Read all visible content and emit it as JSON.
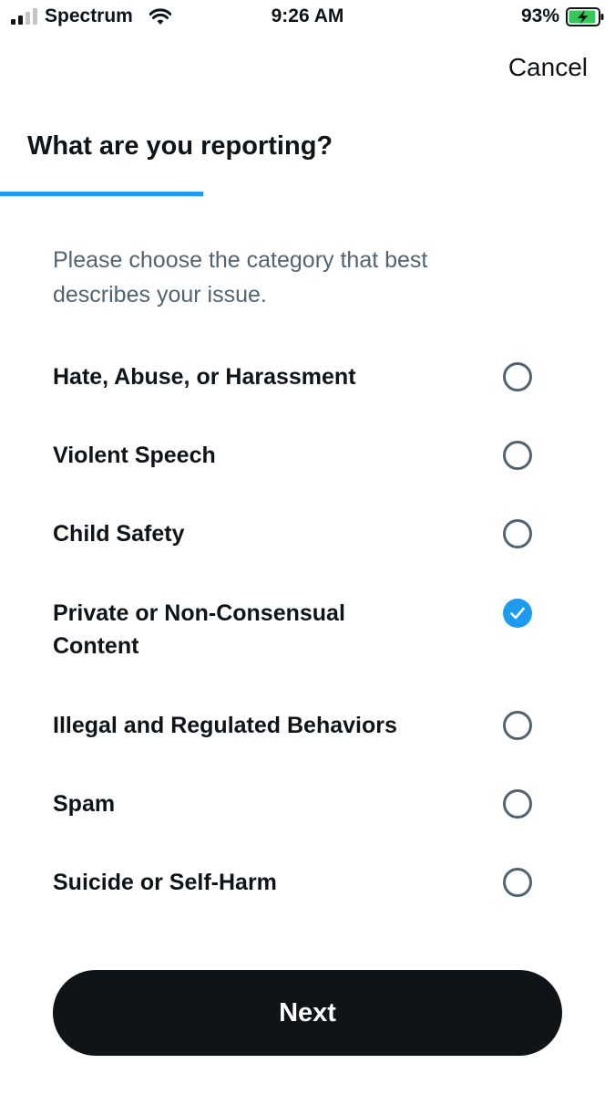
{
  "status_bar": {
    "carrier": "Spectrum",
    "time": "9:26 AM",
    "battery_percent": "93%",
    "battery_level": 0.93,
    "battery_charging": true,
    "signal_bars": 2,
    "battery_color": "#34c759"
  },
  "header": {
    "cancel_label": "Cancel",
    "title": "What are you reporting?",
    "progress": 0.33
  },
  "main": {
    "subtitle": "Please choose the category that best describes your issue.",
    "options": [
      {
        "label": "Hate, Abuse, or Harassment",
        "selected": false
      },
      {
        "label": "Violent Speech",
        "selected": false
      },
      {
        "label": "Child Safety",
        "selected": false
      },
      {
        "label": "Private or Non-Consensual Content",
        "selected": true
      },
      {
        "label": "Illegal and Regulated Behaviors",
        "selected": false
      },
      {
        "label": "Spam",
        "selected": false
      },
      {
        "label": "Suicide or Self-Harm",
        "selected": false
      }
    ]
  },
  "footer": {
    "next_label": "Next"
  },
  "colors": {
    "accent": "#1d9bf0",
    "text": "#0f1419",
    "secondary_text": "#536471",
    "button_bg": "#0f1419"
  }
}
